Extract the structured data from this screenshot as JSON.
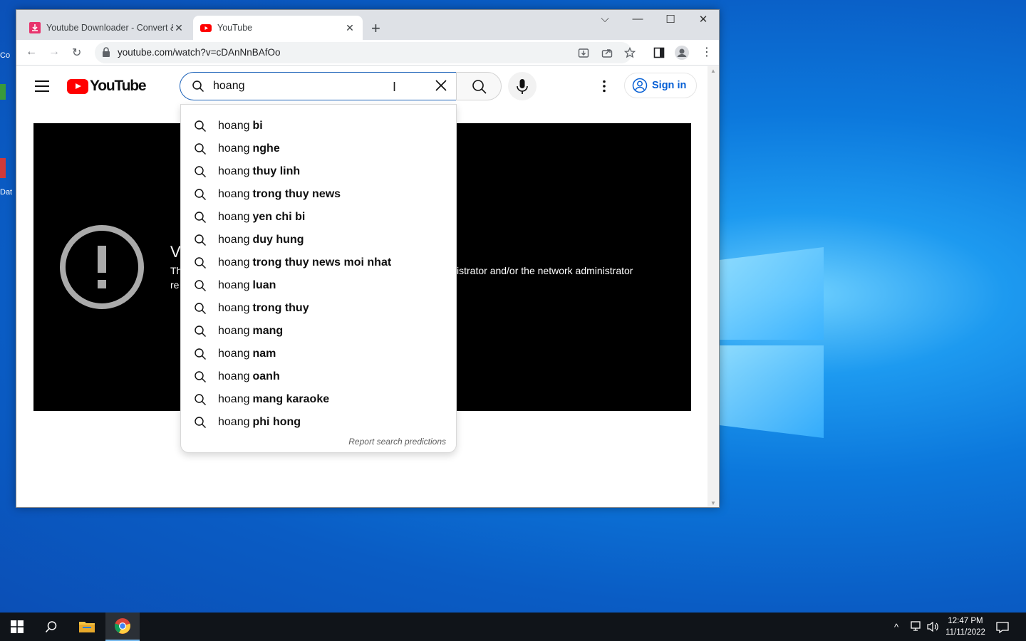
{
  "browser": {
    "tabs": [
      {
        "title": "Youtube Downloader - Convert & Downl",
        "active": false
      },
      {
        "title": "YouTube",
        "active": true
      }
    ],
    "url": "youtube.com/watch?v=cDAnNnBAfOo"
  },
  "youtube": {
    "logo_text": "YouTube",
    "search_value": "hoang",
    "sign_in_label": "Sign in",
    "error": {
      "title": "V",
      "line1_start": "Th",
      "line1_end": "lministrator and/or the network administrator",
      "line2_start": "re"
    },
    "suggestions": [
      {
        "prefix": "hoang",
        "suffix": "bi"
      },
      {
        "prefix": "hoang",
        "suffix": "nghe"
      },
      {
        "prefix": "hoang",
        "suffix": "thuy linh"
      },
      {
        "prefix": "hoang",
        "suffix": "trong thuy news"
      },
      {
        "prefix": "hoang",
        "suffix": "yen chi bi"
      },
      {
        "prefix": "hoang",
        "suffix": "duy hung"
      },
      {
        "prefix": "hoang",
        "suffix": "trong thuy news moi nhat"
      },
      {
        "prefix": "hoang",
        "suffix": "luan"
      },
      {
        "prefix": "hoang",
        "suffix": "trong thuy"
      },
      {
        "prefix": "hoang",
        "suffix": "mang"
      },
      {
        "prefix": "hoang",
        "suffix": "nam"
      },
      {
        "prefix": "hoang",
        "suffix": "oanh"
      },
      {
        "prefix": "hoang",
        "suffix": "mang karaoke"
      },
      {
        "prefix": "hoang",
        "suffix": "phi hong"
      }
    ],
    "report_label": "Report search predictions"
  },
  "desktop": {
    "icon_fragments": [
      "Co",
      "Dat"
    ]
  },
  "taskbar": {
    "time": "12:47 PM",
    "date": "11/11/2022"
  },
  "colors": {
    "youtube_red": "#ff0000",
    "link_blue": "#065fd4",
    "search_focus": "#1c62b9"
  }
}
